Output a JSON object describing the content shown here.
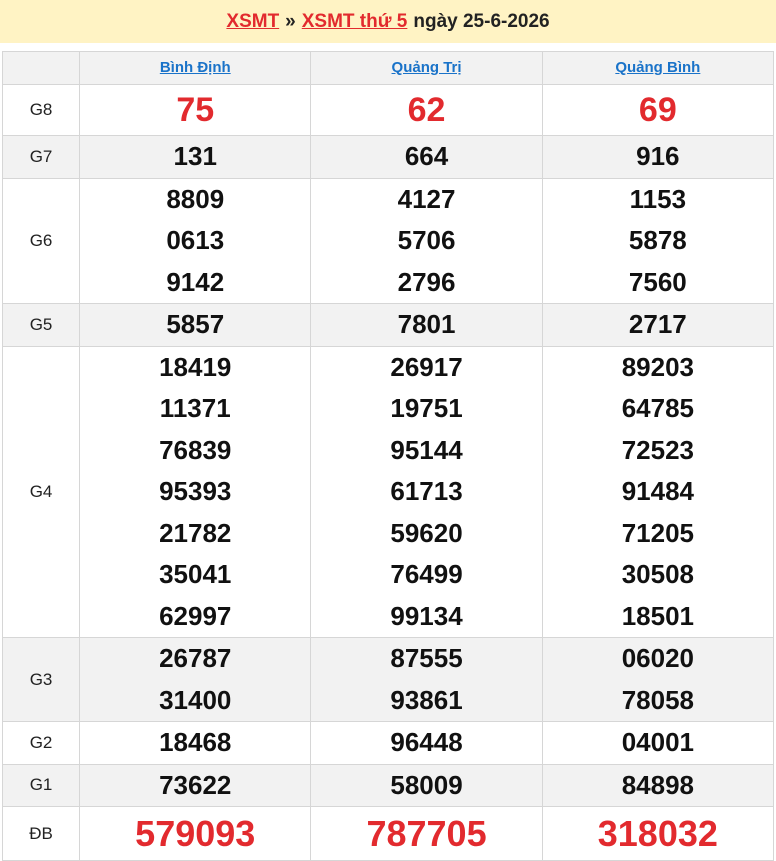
{
  "header": {
    "link1": "XSMT",
    "sep": "»",
    "link2": "XSMT thứ 5",
    "date": "ngày 25-6-2026"
  },
  "provinces": [
    "Bình Định",
    "Quảng Trị",
    "Quảng Bình"
  ],
  "prizes": [
    {
      "label": "G8",
      "style": "g8",
      "alt": false,
      "values": [
        [
          "75"
        ],
        [
          "62"
        ],
        [
          "69"
        ]
      ]
    },
    {
      "label": "G7",
      "style": "",
      "alt": true,
      "values": [
        [
          "131"
        ],
        [
          "664"
        ],
        [
          "916"
        ]
      ]
    },
    {
      "label": "G6",
      "style": "",
      "alt": false,
      "values": [
        [
          "8809",
          "0613",
          "9142"
        ],
        [
          "4127",
          "5706",
          "2796"
        ],
        [
          "1153",
          "5878",
          "7560"
        ]
      ]
    },
    {
      "label": "G5",
      "style": "",
      "alt": true,
      "values": [
        [
          "5857"
        ],
        [
          "7801"
        ],
        [
          "2717"
        ]
      ]
    },
    {
      "label": "G4",
      "style": "",
      "alt": false,
      "values": [
        [
          "18419",
          "11371",
          "76839",
          "95393",
          "21782",
          "35041",
          "62997"
        ],
        [
          "26917",
          "19751",
          "95144",
          "61713",
          "59620",
          "76499",
          "99134"
        ],
        [
          "89203",
          "64785",
          "72523",
          "91484",
          "71205",
          "30508",
          "18501"
        ]
      ]
    },
    {
      "label": "G3",
      "style": "",
      "alt": true,
      "values": [
        [
          "26787",
          "31400"
        ],
        [
          "87555",
          "93861"
        ],
        [
          "06020",
          "78058"
        ]
      ]
    },
    {
      "label": "G2",
      "style": "",
      "alt": false,
      "values": [
        [
          "18468"
        ],
        [
          "96448"
        ],
        [
          "04001"
        ]
      ]
    },
    {
      "label": "G1",
      "style": "",
      "alt": true,
      "values": [
        [
          "73622"
        ],
        [
          "58009"
        ],
        [
          "84898"
        ]
      ]
    },
    {
      "label": "ĐB",
      "style": "db",
      "alt": false,
      "values": [
        [
          "579093"
        ],
        [
          "787705"
        ],
        [
          "318032"
        ]
      ]
    }
  ],
  "colors": {
    "accent_red": "#e22a2e",
    "link_blue": "#1a73c9",
    "header_bg": "#fff3c4"
  }
}
